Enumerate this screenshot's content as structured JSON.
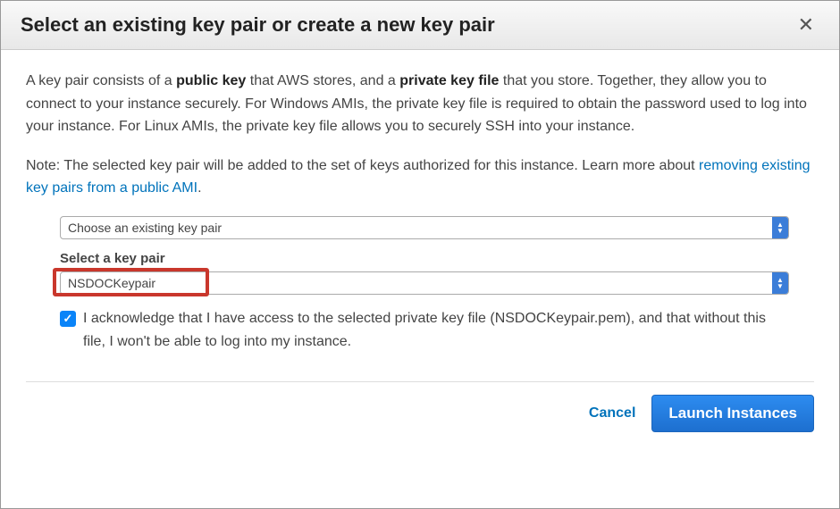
{
  "header": {
    "title": "Select an existing key pair or create a new key pair"
  },
  "description": {
    "part1": "A key pair consists of a ",
    "bold1": "public key",
    "part2": " that AWS stores, and a ",
    "bold2": "private key file",
    "part3": " that you store. Together, they allow you to connect to your instance securely. For Windows AMIs, the private key file is required to obtain the password used to log into your instance. For Linux AMIs, the private key file allows you to securely SSH into your instance."
  },
  "note": {
    "text": "Note: The selected key pair will be added to the set of keys authorized for this instance. Learn more about ",
    "link": "removing existing key pairs from a public AMI",
    "suffix": "."
  },
  "form": {
    "select1_value": "Choose an existing key pair",
    "select2_label": "Select a key pair",
    "select2_value": "NSDOCKeypair",
    "ack_text": "I acknowledge that I have access to the selected private key file (NSDOCKeypair.pem), and that without this file, I won't be able to log into my instance."
  },
  "footer": {
    "cancel": "Cancel",
    "launch": "Launch Instances"
  }
}
